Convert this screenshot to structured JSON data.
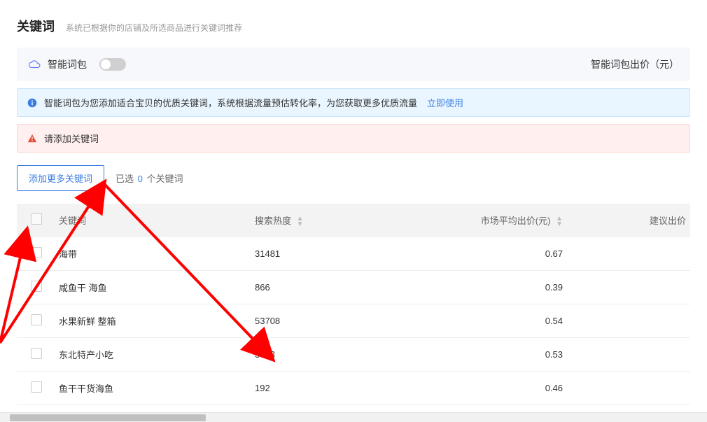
{
  "header": {
    "title": "关键词",
    "subtitle": "系统已根据你的店铺及所选商品进行关键词推荐"
  },
  "smart": {
    "label": "智能词包",
    "bid_label": "智能词包出价（元）"
  },
  "info_banner": {
    "text": "智能词包为您添加适合宝贝的优质关键词，系统根据流量预估转化率，为您获取更多优质流量",
    "link": "立即使用"
  },
  "warn_banner": {
    "text": "请添加关键词"
  },
  "actions": {
    "add_btn": "添加更多关键词",
    "selected_prefix": "已选",
    "selected_count": "0",
    "selected_suffix": "个关键词"
  },
  "columns": {
    "keyword": "关键词",
    "heat": "搜索热度",
    "avg_price": "市场平均出价(元)",
    "suggest_price": "建议出价"
  },
  "rows": [
    {
      "keyword": "海带",
      "heat": "31481",
      "avg_price": "0.67"
    },
    {
      "keyword": "咸鱼干 海鱼",
      "heat": "866",
      "avg_price": "0.39"
    },
    {
      "keyword": "水果新鲜 整箱",
      "heat": "53708",
      "avg_price": "0.54"
    },
    {
      "keyword": "东北特产小吃",
      "heat": "3653",
      "avg_price": "0.53"
    },
    {
      "keyword": "鱼干干货海鱼",
      "heat": "192",
      "avg_price": "0.46"
    }
  ]
}
